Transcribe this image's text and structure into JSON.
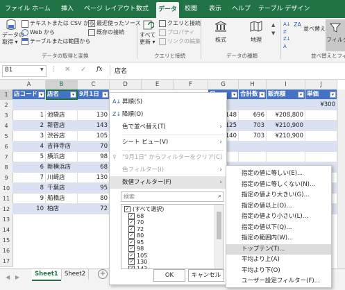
{
  "ribbon_tabs": [
    "ファイル",
    "ホーム",
    "挿入",
    "ページ レイアウト",
    "数式",
    "データ",
    "校閲",
    "表示",
    "ヘルプ",
    "テーブル デザイン"
  ],
  "ribbon": {
    "get_data_l1": "データの",
    "get_data_l2": "取得 ▾",
    "from_text_csv": "テキストまたは CSV から",
    "from_web": "Web から",
    "from_table_range": "テーブルまたは範囲から",
    "recent_sources": "最近使ったソース",
    "existing_connections": "既存の接続",
    "group_get_transform": "データの取得と変換",
    "refresh_all_l1": "すべて",
    "refresh_all_l2": "更新 ▾",
    "queries_connections": "クエリと接続",
    "properties": "プロパティ",
    "edit_links": "リンクの編集",
    "group_queries": "クエリと接続",
    "stocks": "株式",
    "geography": "地理",
    "group_data_types": "データの種類",
    "sort": "並べ替え",
    "filter": "フィルター",
    "group_sort_filter": "並べ替えとフィル"
  },
  "formula_bar": {
    "name_box": "B1",
    "fx": "fx",
    "content": "店名"
  },
  "grid": {
    "columns": [
      "A",
      "B",
      "C",
      "D",
      "E",
      "F",
      "G",
      "H",
      "I",
      "J"
    ],
    "rows": [
      "1",
      "2",
      "3",
      "4",
      "5",
      "6",
      "7",
      "8",
      "9",
      "10",
      "11",
      "12",
      "13",
      "14",
      "15",
      "16",
      "17"
    ],
    "header_row": {
      "a": "店コード",
      "b": "店名",
      "c": "9月1日",
      "g": "日",
      "h": "合計数",
      "i": "販売額",
      "j": "単価"
    },
    "j2": "¥300",
    "data_rows": [
      {
        "code": "1",
        "name": "池袋店",
        "c": "130",
        "g": "148",
        "h": "696",
        "i": "¥208,800"
      },
      {
        "code": "2",
        "name": "新宿店",
        "c": "143",
        "g": "125",
        "h": "703",
        "i": "¥210,900"
      },
      {
        "code": "3",
        "name": "渋谷店",
        "c": "105",
        "g": "140",
        "h": "703",
        "i": "¥210,900"
      },
      {
        "code": "4",
        "name": "吉祥寺店",
        "c": "70"
      },
      {
        "code": "5",
        "name": "横浜店",
        "c": "98"
      },
      {
        "code": "6",
        "name": "新横浜店",
        "c": "68"
      },
      {
        "code": "7",
        "name": "川崎店",
        "c": "130"
      },
      {
        "code": "8",
        "name": "千葉店",
        "c": "95"
      },
      {
        "code": "9",
        "name": "船橋店",
        "c": "80"
      },
      {
        "code": "10",
        "name": "柏店",
        "c": "72"
      }
    ]
  },
  "context_menu": {
    "sort_asc": "昇順(S)",
    "sort_desc": "降順(O)",
    "sort_by_color": "色で並べ替え(T)",
    "sheet_view": "シート ビュー(V)",
    "clear_filter": "\"9月1日\" からフィルターをクリア(C)",
    "filter_by_color": "色フィルター(I)",
    "number_filters": "数値フィルター(F)",
    "search_placeholder": "検索",
    "checklist": [
      "(すべて選択)",
      "68",
      "70",
      "72",
      "80",
      "95",
      "98",
      "105",
      "130",
      "143"
    ],
    "ok": "OK",
    "cancel": "キャンセル"
  },
  "submenu": [
    "指定の値に等しい(E)...",
    "指定の値に等しくない(N)...",
    "指定の値より大きい(G)...",
    "指定の値以上(O)...",
    "指定の値より小さい(L)...",
    "指定の値以下(Q)...",
    "指定の範囲内(W)...",
    "トップテン(T)...",
    "平均より上(A)",
    "平均より下(O)",
    "ユーザー設定フィルター(F)..."
  ],
  "sheets": [
    "Sheet1",
    "Sheet2"
  ],
  "colors": {
    "excel_green": "#217346",
    "table_header": "#4472c4",
    "table_band": "#d9e1f2",
    "highlight": "#dcdcdc"
  }
}
